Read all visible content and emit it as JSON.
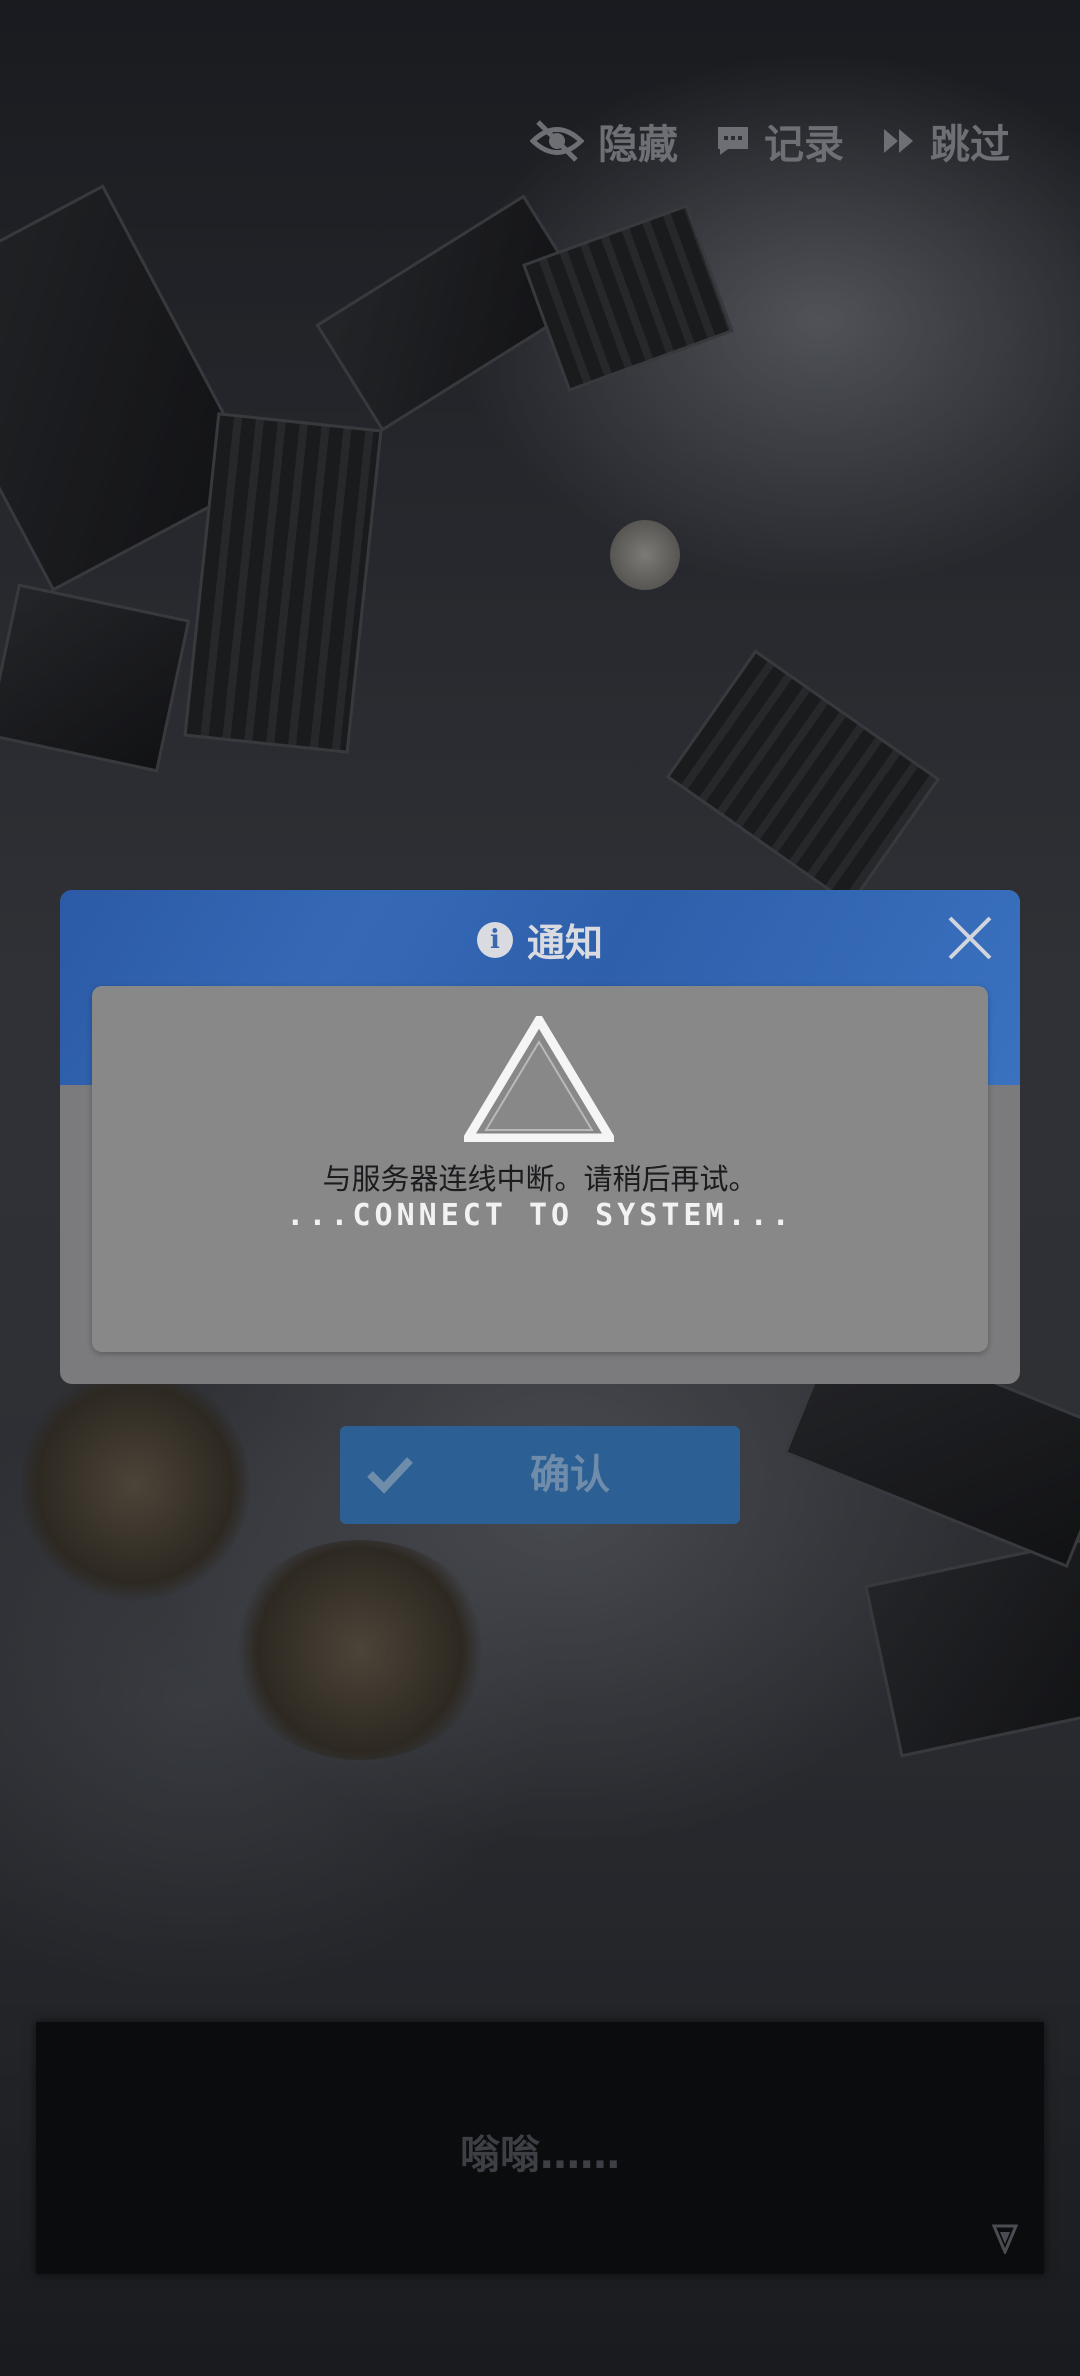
{
  "top_controls": {
    "hide_label": "隐藏",
    "log_label": "记录",
    "skip_label": "跳过"
  },
  "dialog": {
    "title": "通知",
    "message_cn": "与服务器连线中断。请稍后再试。",
    "message_en": "...CONNECT TO SYSTEM...",
    "confirm_label": "确认"
  },
  "speech": {
    "text": "嗡嗡……"
  },
  "colors": {
    "header_blue": "#2e5fab",
    "confirm_blue": "#2c5f93",
    "dialog_gray": "#7b7b7d"
  }
}
